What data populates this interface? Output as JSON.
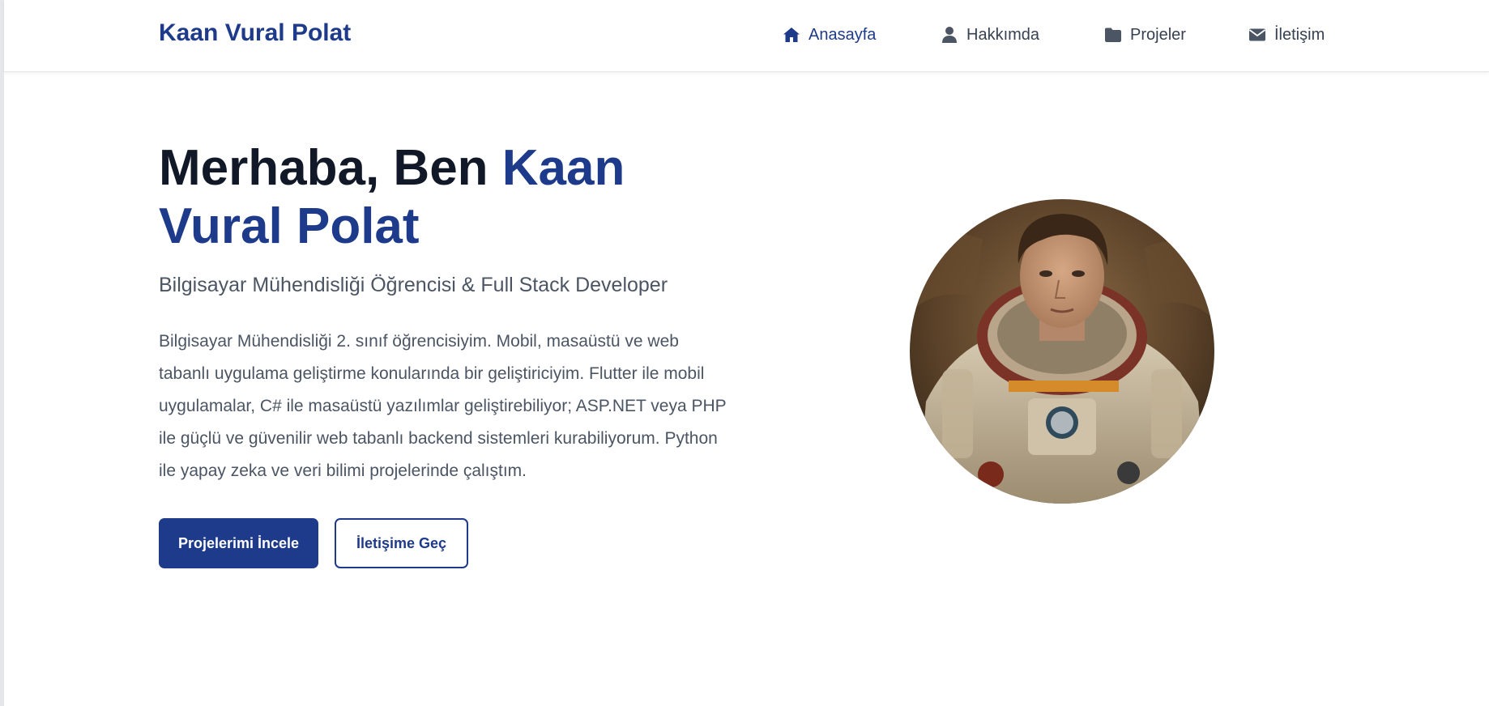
{
  "header": {
    "brand": "Kaan Vural Polat",
    "nav": [
      {
        "label": "Anasayfa",
        "icon": "home-icon",
        "active": true
      },
      {
        "label": "Hakkımda",
        "icon": "user-icon",
        "active": false
      },
      {
        "label": "Projeler",
        "icon": "folder-icon",
        "active": false
      },
      {
        "label": "İletişim",
        "icon": "envelope-icon",
        "active": false
      }
    ]
  },
  "hero": {
    "title_prefix": "Merhaba, Ben ",
    "title_name": "Kaan Vural Polat",
    "subtitle": "Bilgisayar Mühendisliği Öğrencisi & Full Stack Developer",
    "description": "Bilgisayar Mühendisliği 2. sınıf öğrencisiyim. Mobil, masaüstü ve web tabanlı uygulama geliştirme konularında bir geliştiriciyim. Flutter ile mobil uygulamalar, C# ile masaüstü yazılımlar geliştirebiliyor; ASP.NET veya PHP ile güçlü ve güvenilir web tabanlı backend sistemleri kurabiliyorum. Python ile yapay zeka ve veri bilimi projelerinde çalıştım.",
    "primary_button": "Projelerimi İncele",
    "secondary_button": "İletişime Geç"
  },
  "colors": {
    "accent": "#1e3a8a",
    "heading": "#111827",
    "text": "#4b5563"
  }
}
